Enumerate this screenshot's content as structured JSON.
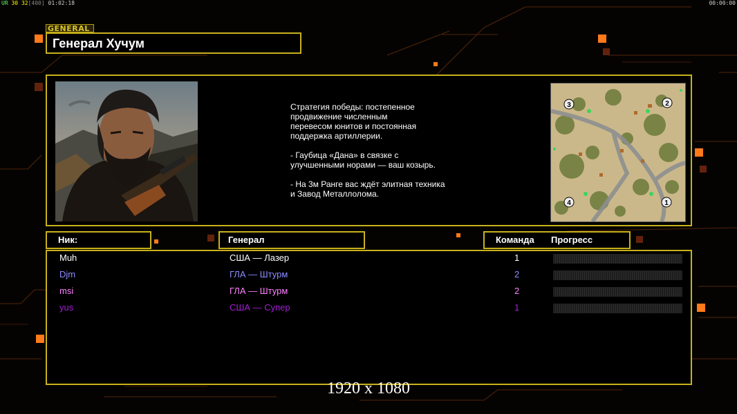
{
  "overlay": {
    "fps_a": "UR",
    "fps_b": "30",
    "fps_c": "32",
    "fps_d": "[400]",
    "fps_e": "01:02:18",
    "clock": "00:00:00"
  },
  "general_tag": "GENERAL",
  "title": "Генерал Хучум",
  "description": "Стратегия победы: постепенное\nпродвижение численным\nперевесом юнитов и постоянная\nподдержка артиллерии.\n\n- Гаубица «Дана» в связке с\nулучшенными норами — ваш козырь.\n\n- На 3м Ранге вас ждёт элитная техника\nи Завод Металлолома.",
  "minimap": {
    "start_positions": [
      "1",
      "2",
      "3",
      "4"
    ]
  },
  "headers": {
    "nick": "Ник:",
    "general": "Генерал",
    "team": "Команда",
    "progress": "Прогресс"
  },
  "players": [
    {
      "nick": "Muh",
      "general": "США — Лазер",
      "team": "1",
      "color": "#ffffff"
    },
    {
      "nick": "Djm",
      "general": "ГЛА — Штурм",
      "team": "2",
      "color": "#8c8cff"
    },
    {
      "nick": "msi",
      "general": "ГЛА — Штурм",
      "team": "2",
      "color": "#ff80ff"
    },
    {
      "nick": "yus",
      "general": "США — Супер",
      "team": "1",
      "color": "#a020d0"
    }
  ],
  "resolution": "1920 x 1080",
  "colors": {
    "frame": "#c9b21b",
    "accent_orange": "#ff7a1a"
  }
}
